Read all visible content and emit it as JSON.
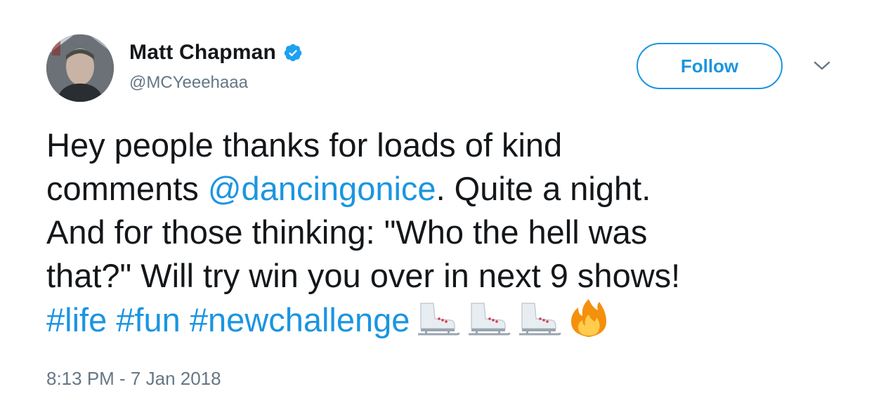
{
  "author": {
    "display_name": "Matt Chapman",
    "handle": "@MCYeeehaaa",
    "verified": true
  },
  "follow_button": {
    "label": "Follow"
  },
  "tweet": {
    "line1": "Hey people thanks for loads of kind",
    "line2_prefix": "comments ",
    "mention": "@dancingonice",
    "line2_suffix": ". Quite a night.",
    "line3": "And for those thinking: \"Who the hell was",
    "line4": "that?\" Will try win you over in next 9 shows!",
    "hashtags": [
      "#life",
      "#fun",
      "#newchallenge"
    ],
    "emojis": [
      "ice-skate",
      "ice-skate",
      "ice-skate",
      "fire"
    ]
  },
  "timestamp": "8:13 PM - 7 Jan 2018",
  "colors": {
    "link": "#1b95e0",
    "text": "#14171a",
    "secondary": "#657786"
  }
}
